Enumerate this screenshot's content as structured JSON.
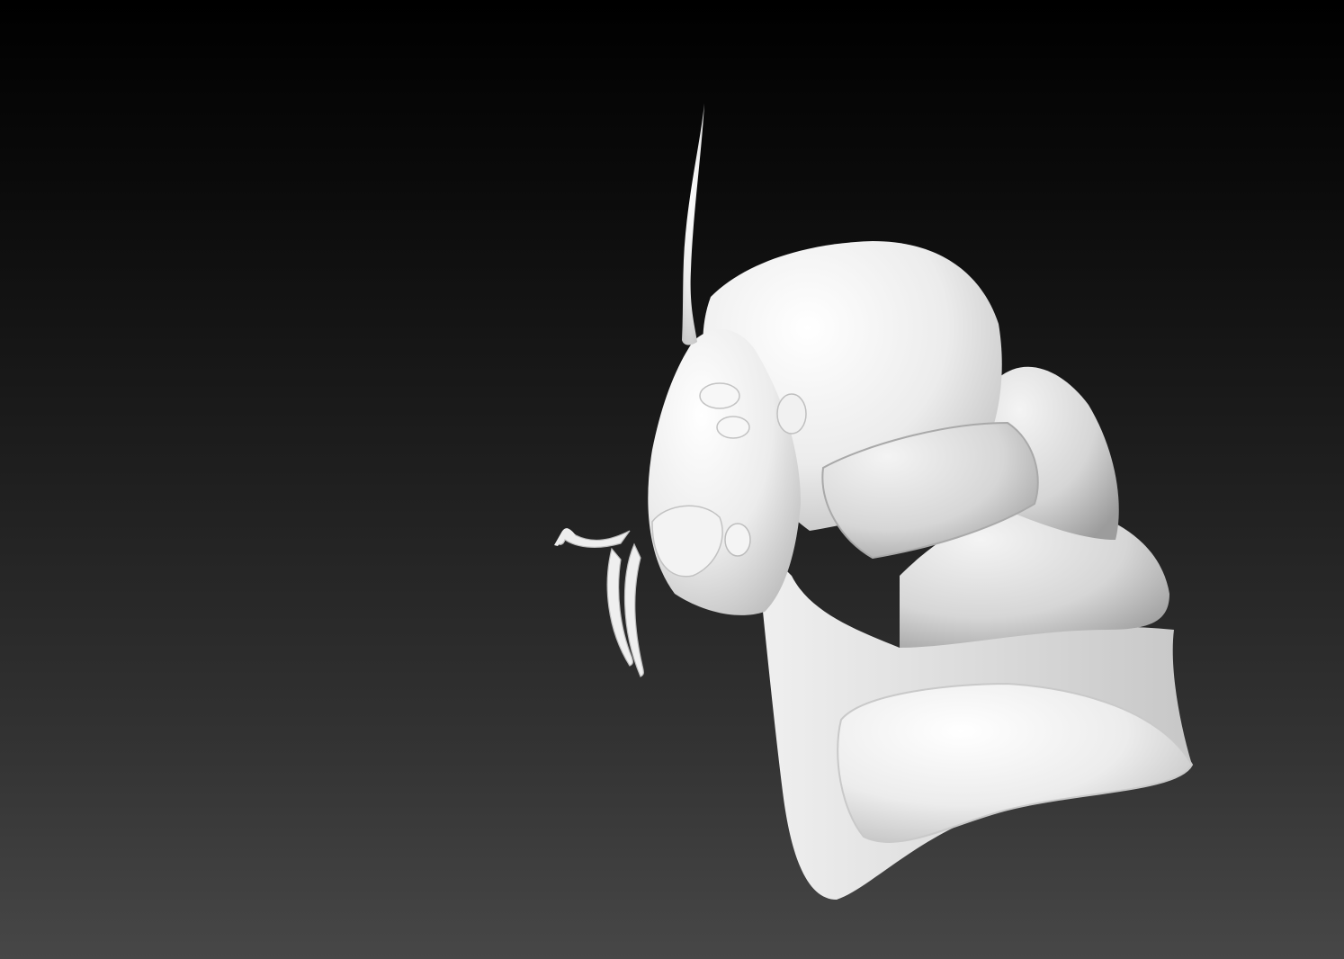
{
  "viewport": {
    "background_top": "#000000",
    "background_bottom": "#474747"
  },
  "sculpt": {
    "material_color": "#f2f2f2",
    "shadow_color": "#bdbdbd",
    "icon": "creature-bust-sculpt"
  }
}
